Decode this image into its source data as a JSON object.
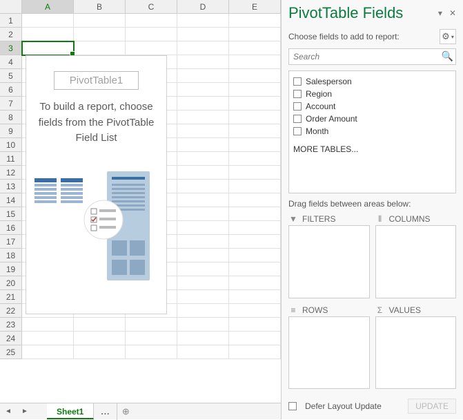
{
  "columns": [
    "A",
    "B",
    "C",
    "D",
    "E"
  ],
  "active_col": "A",
  "rows": [
    1,
    2,
    3,
    4,
    5,
    6,
    7,
    8,
    9,
    10,
    11,
    12,
    13,
    14,
    15,
    16,
    17,
    18,
    19,
    20,
    21,
    22,
    23,
    24,
    25
  ],
  "active_row": 3,
  "overlay": {
    "title": "PivotTable1",
    "text_l1": "To build a report, choose",
    "text_l2": "fields from the PivotTable",
    "text_l3": "Field List"
  },
  "tabs": {
    "sheet1": "Sheet1",
    "more": "...",
    "add_title": "New sheet"
  },
  "pane": {
    "title": "PivotTable Fields",
    "sub": "Choose fields to add to report:",
    "search_placeholder": "Search",
    "fields": [
      "Salesperson",
      "Region",
      "Account",
      "Order Amount",
      "Month"
    ],
    "more_tables": "MORE TABLES...",
    "drag_label": "Drag fields between areas below:",
    "areas": {
      "filters": "FILTERS",
      "columns": "COLUMNS",
      "rows": "ROWS",
      "values": "VALUES"
    },
    "defer": "Defer Layout Update",
    "update": "UPDATE"
  }
}
